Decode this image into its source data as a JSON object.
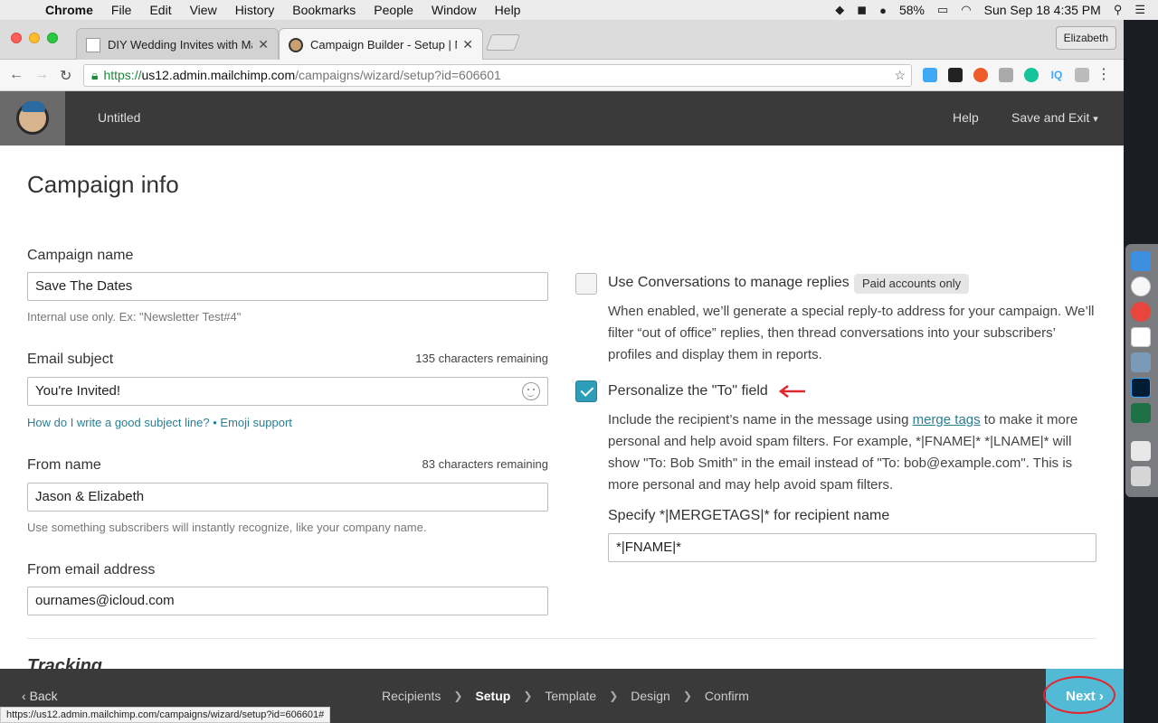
{
  "menubar": {
    "app": "Chrome",
    "items": [
      "File",
      "Edit",
      "View",
      "History",
      "Bookmarks",
      "People",
      "Window",
      "Help"
    ],
    "battery": "58%",
    "clock": "Sun Sep 18  4:35 PM"
  },
  "browser": {
    "tabs": [
      {
        "title": "DIY Wedding Invites with Mailc"
      },
      {
        "title": "Campaign Builder - Setup | Ma"
      }
    ],
    "profile": "Elizabeth",
    "url_https": "https://",
    "url_host": "us12.admin.mailchimp.com",
    "url_path": "/campaigns/wizard/setup?id=606601",
    "status_url": "https://us12.admin.mailchimp.com/campaigns/wizard/setup?id=606601#"
  },
  "header": {
    "title": "Untitled",
    "help": "Help",
    "save_exit": "Save and Exit"
  },
  "page": {
    "heading": "Campaign info",
    "campaign_name": {
      "label": "Campaign name",
      "value": "Save The Dates",
      "hint": "Internal use only. Ex: \"Newsletter Test#4\""
    },
    "email_subject": {
      "label": "Email subject",
      "count": "135 characters remaining",
      "value": "You're Invited!",
      "link1": "How do I write a good subject line?",
      "sep": " • ",
      "link2": "Emoji support"
    },
    "from_name": {
      "label": "From name",
      "count": "83 characters remaining",
      "value": "Jason & Elizabeth",
      "hint": "Use something subscribers will instantly recognize, like your company name."
    },
    "from_email": {
      "label": "From email address",
      "value": "ournames@icloud.com"
    },
    "conversations": {
      "title": "Use Conversations to manage replies",
      "badge": "Paid accounts only",
      "desc": "When enabled, we’ll generate a special reply-to address for your campaign. We’ll filter “out of office” replies, then thread conversations into your subscribers’ profiles and display them in reports.",
      "checked": false
    },
    "personalize": {
      "title": "Personalize the \"To\" field",
      "checked": true,
      "desc_before": "Include the recipient’s name in the message using ",
      "desc_link": "merge tags",
      "desc_after": " to make it more personal and help avoid spam filters. For example, *|FNAME|* *|LNAME|* will show \"To: Bob Smith\" in the email instead of \"To: bob@example.com\". This is more personal and may help avoid spam filters.",
      "merge_label": "Specify *|MERGETAGS|* for recipient name",
      "merge_value": "*|FNAME|*"
    },
    "tracking": "Tracking"
  },
  "footer": {
    "back": "Back",
    "steps": [
      "Recipients",
      "Setup",
      "Template",
      "Design",
      "Confirm"
    ],
    "current_step": "Setup",
    "next": "Next"
  },
  "colors": {
    "accent": "#52bad5",
    "link": "#2a7e94",
    "header_bg": "#3a3a3a",
    "annotation": "#e3262e"
  }
}
